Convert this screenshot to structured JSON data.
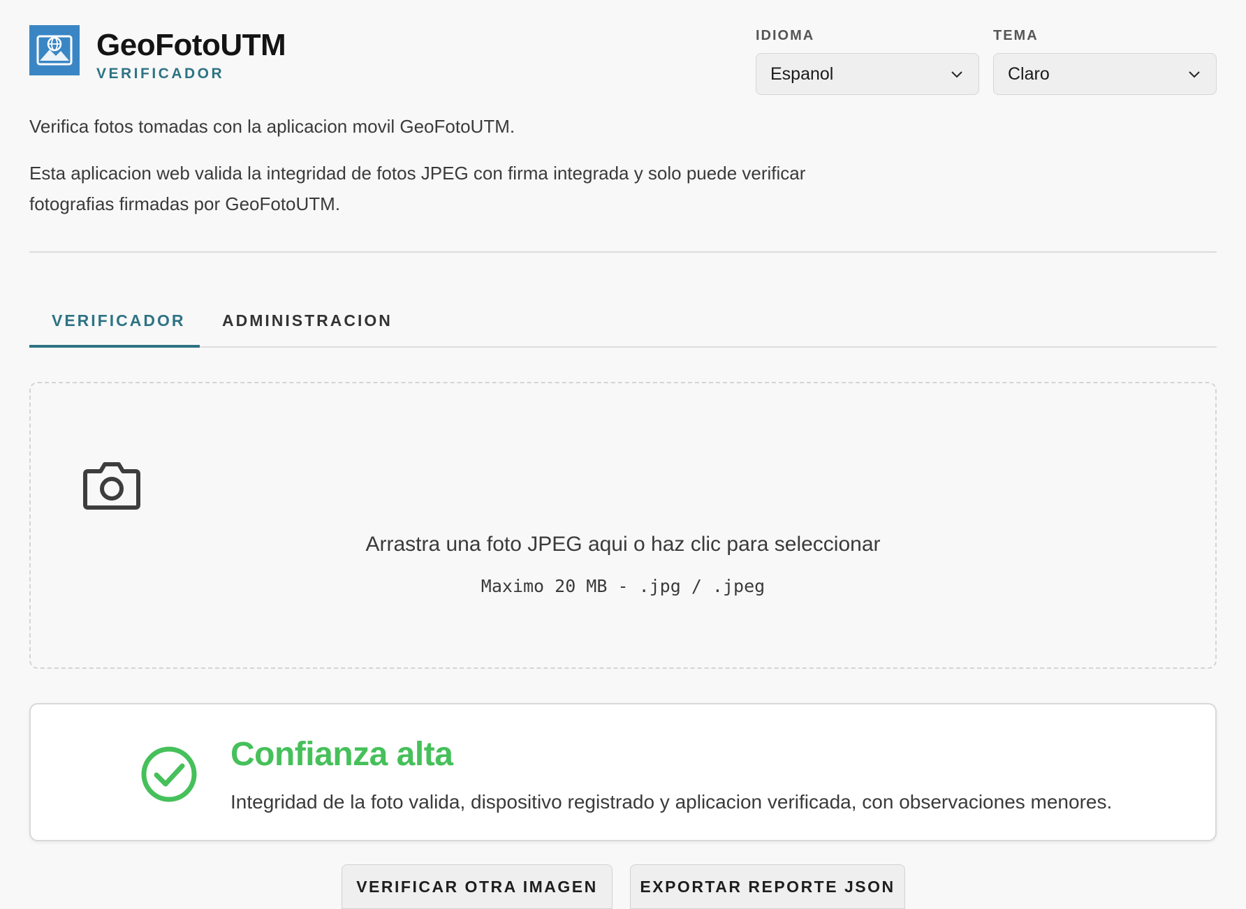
{
  "brand": {
    "title": "GeoFotoUTM",
    "subtitle": "VERIFICADOR",
    "logo_icon": "photo-globe-icon"
  },
  "language": {
    "label": "IDIOMA",
    "value": "Espanol"
  },
  "theme": {
    "label": "TEMA",
    "value": "Claro"
  },
  "intro": {
    "line1": "Verifica fotos tomadas con la aplicacion movil GeoFotoUTM.",
    "line2": "Esta aplicacion web valida la integridad de fotos JPEG con firma integrada y solo puede verificar fotografias firmadas por GeoFotoUTM."
  },
  "tabs": [
    {
      "label": "VERIFICADOR",
      "active": true
    },
    {
      "label": "ADMINISTRACION",
      "active": false
    }
  ],
  "dropzone": {
    "icon": "camera-icon",
    "title": "Arrastra una foto JPEG aqui o haz clic para seleccionar",
    "hint": "Maximo 20 MB - .jpg / .jpeg"
  },
  "result": {
    "icon": "check-circle-icon",
    "title": "Confianza alta",
    "description": "Integridad de la foto valida, dispositivo registrado y aplicacion verificada, con observaciones menores.",
    "color": "#46c05a"
  },
  "actions": {
    "verify_other": "VERIFICAR OTRA IMAGEN",
    "export_json": "EXPORTAR REPORTE JSON"
  },
  "colors": {
    "accent": "#2e7384",
    "logo_bg": "#3a86c4",
    "success": "#46c05a"
  }
}
